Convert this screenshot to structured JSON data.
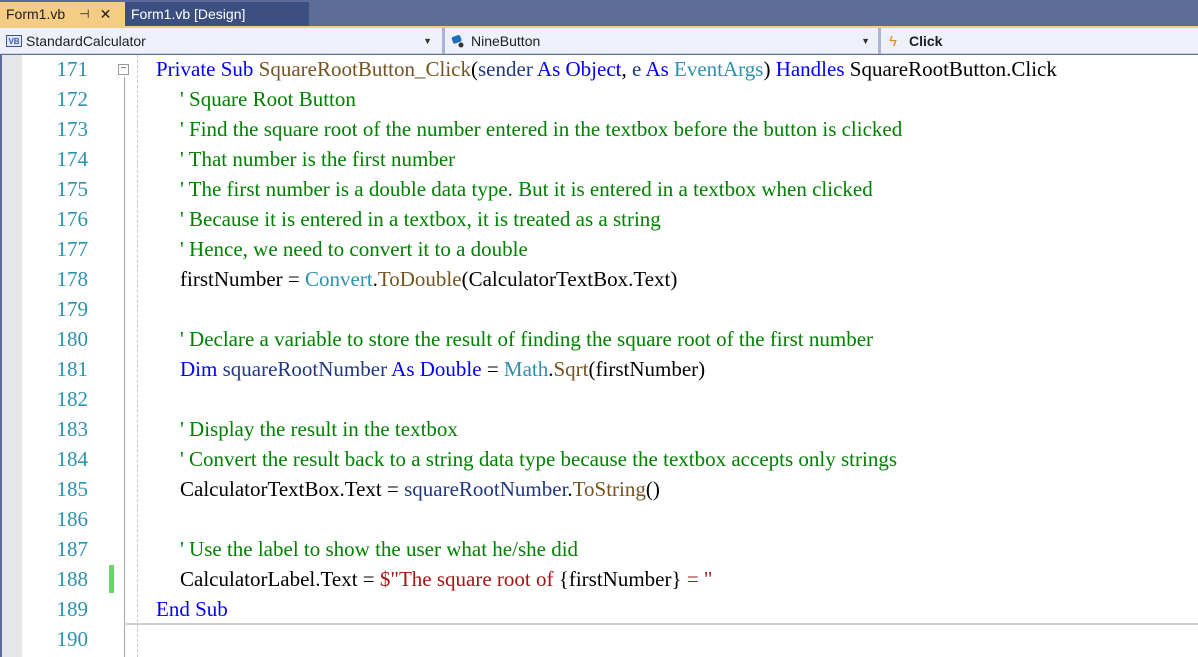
{
  "tabs": [
    {
      "label": "Form1.vb",
      "active": true
    },
    {
      "label": "Form1.vb [Design]",
      "active": false
    }
  ],
  "navbar": {
    "project_icon": "VB",
    "project": "StandardCalculator",
    "object": "NineButton",
    "event": "Click"
  },
  "colors": {
    "keyword": "#0000ff",
    "comment": "#008000",
    "type": "#2b91af",
    "method": "#74531f",
    "string": "#a31515",
    "line_number": "#2b91af",
    "active_tab": "#f5cc84"
  },
  "lines": [
    {
      "n": "171",
      "parts": [
        [
          "kw",
          "Private Sub "
        ],
        [
          "mt",
          "SquareRootButton_Click"
        ],
        [
          "",
          "("
        ],
        [
          "lv",
          "sender"
        ],
        [
          "kw",
          " As "
        ],
        [
          "kw",
          "Object"
        ],
        [
          "",
          ", "
        ],
        [
          "lv",
          "e"
        ],
        [
          "kw",
          " As "
        ],
        [
          "ty",
          "EventArgs"
        ],
        [
          "",
          ") "
        ],
        [
          "kw",
          "Handles"
        ],
        [
          "",
          " SquareRootButton.Click"
        ]
      ]
    },
    {
      "n": "172",
      "parts": [
        [
          "cm",
          "' Square Root Button"
        ]
      ]
    },
    {
      "n": "173",
      "parts": [
        [
          "cm",
          "' Find the square root of the number entered in the textbox before the button is clicked"
        ]
      ]
    },
    {
      "n": "174",
      "parts": [
        [
          "cm",
          "' That number is the first number"
        ]
      ]
    },
    {
      "n": "175",
      "parts": [
        [
          "cm",
          "' The first number is a double data type. But it is entered in a textbox when clicked"
        ]
      ]
    },
    {
      "n": "176",
      "parts": [
        [
          "cm",
          "' Because it is entered in a textbox, it is treated as a string"
        ]
      ]
    },
    {
      "n": "177",
      "parts": [
        [
          "cm",
          "' Hence, we need to convert it to a double"
        ]
      ]
    },
    {
      "n": "178",
      "parts": [
        [
          "",
          "firstNumber = "
        ],
        [
          "ty",
          "Convert"
        ],
        [
          "",
          "."
        ],
        [
          "mt",
          "ToDouble"
        ],
        [
          "",
          "(CalculatorTextBox.Text)"
        ]
      ]
    },
    {
      "n": "179",
      "parts": []
    },
    {
      "n": "180",
      "parts": [
        [
          "cm",
          "' Declare a variable to store the result of finding the square root of the first number"
        ]
      ]
    },
    {
      "n": "181",
      "parts": [
        [
          "kw",
          "Dim "
        ],
        [
          "lv",
          "squareRootNumber"
        ],
        [
          "kw",
          " As Double"
        ],
        [
          "",
          " = "
        ],
        [
          "ty",
          "Math"
        ],
        [
          "",
          "."
        ],
        [
          "mt",
          "Sqrt"
        ],
        [
          "",
          "(firstNumber)"
        ]
      ]
    },
    {
      "n": "182",
      "parts": []
    },
    {
      "n": "183",
      "parts": [
        [
          "cm",
          "' Display the result in the textbox"
        ]
      ]
    },
    {
      "n": "184",
      "parts": [
        [
          "cm",
          "' Convert the result back to a string data type because the textbox accepts only strings"
        ]
      ]
    },
    {
      "n": "185",
      "parts": [
        [
          "",
          "CalculatorTextBox.Text = "
        ],
        [
          "lv",
          "squareRootNumber"
        ],
        [
          "",
          "."
        ],
        [
          "mt",
          "ToString"
        ],
        [
          "",
          "()"
        ]
      ]
    },
    {
      "n": "186",
      "parts": []
    },
    {
      "n": "187",
      "parts": [
        [
          "cm",
          "' Use the label to show the user what he/she did"
        ]
      ]
    },
    {
      "n": "188",
      "parts": [
        [
          "",
          "CalculatorLabel.Text = "
        ],
        [
          "st",
          "$\"The square root of "
        ],
        [
          "",
          "{firstNumber}"
        ],
        [
          "st",
          " = \""
        ]
      ]
    },
    {
      "n": "189",
      "parts": [
        [
          "kw",
          "End Sub"
        ]
      ]
    },
    {
      "n": "190",
      "parts": []
    }
  ]
}
